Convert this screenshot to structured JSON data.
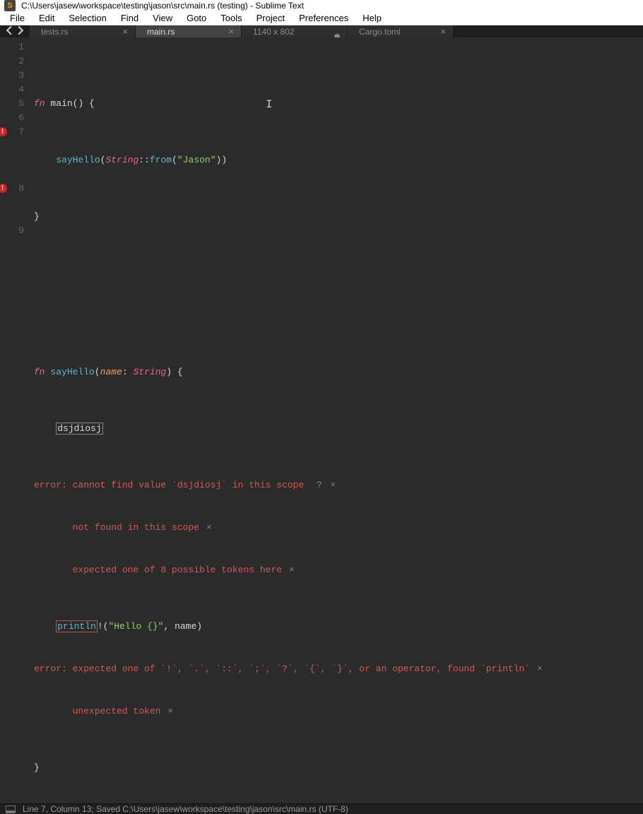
{
  "window": {
    "title": "C:\\Users\\jasew\\workspace\\testing\\jason\\src\\main.rs (testing) - Sublime Text"
  },
  "menu": {
    "file": "File",
    "edit": "Edit",
    "selection": "Selection",
    "find": "Find",
    "view": "View",
    "goto": "Goto",
    "tools": "Tools",
    "project": "Project",
    "preferences": "Preferences",
    "help": "Help"
  },
  "tabs": [
    {
      "label": "tests.rs",
      "active": false,
      "dirty": false
    },
    {
      "label": "main.rs",
      "active": true,
      "dirty": false
    },
    {
      "label": "1140 x 802",
      "active": false,
      "dirty": true
    },
    {
      "label": "Cargo.toml",
      "active": false,
      "dirty": false
    }
  ],
  "gutter": {
    "lines": [
      "1",
      "2",
      "3",
      "4",
      "5",
      "6",
      "7",
      "",
      "",
      "",
      "8",
      "",
      "",
      "9"
    ],
    "errors": {
      "7": true,
      "8": true
    }
  },
  "code": {
    "l1": {
      "fn": "fn",
      "name": "main",
      "rest": "() {"
    },
    "l2": {
      "indent": "    ",
      "call": "sayHello",
      "p1": "(",
      "type": "String",
      "dbl": "::",
      "method": "from",
      "p2": "(",
      "str": "\"Jason\"",
      "p3": "))"
    },
    "l3": {
      "brace": "}"
    },
    "l6": {
      "fn": "fn",
      "name": "sayHello",
      "p1": "(",
      "param": "name",
      "colon": ": ",
      "ptype": "String",
      "p2": ") {"
    },
    "l7": {
      "indent": "    ",
      "boxed": "dsjdiosj"
    },
    "l7e1": {
      "text": "error: cannot find value `dsjdiosj` in this scope",
      "q": "?",
      "x": "×"
    },
    "l7e2": {
      "indent": "       ",
      "text": "not found in this scope",
      "x": "×"
    },
    "l7e3": {
      "indent": "       ",
      "text": "expected one of 8 possible tokens here",
      "x": "×"
    },
    "l8": {
      "indent": "    ",
      "boxed": "println",
      "bang": "!",
      "p1": "(",
      "str": "\"Hello {}\"",
      "comma": ", name)"
    },
    "l8e1": {
      "text": "error: expected one of `!`, `.`, `::`, `;`, `?`, `{`, `}`, or an operator, found `println`",
      "x": "×"
    },
    "l8e2": {
      "indent": "       ",
      "text": "unexpected token",
      "x": "×"
    },
    "l9": {
      "brace": "}"
    }
  },
  "status": {
    "text": "Line 7, Column 13; Saved C:\\Users\\jasew\\workspace\\testing\\jason\\src\\main.rs (UTF-8)"
  }
}
